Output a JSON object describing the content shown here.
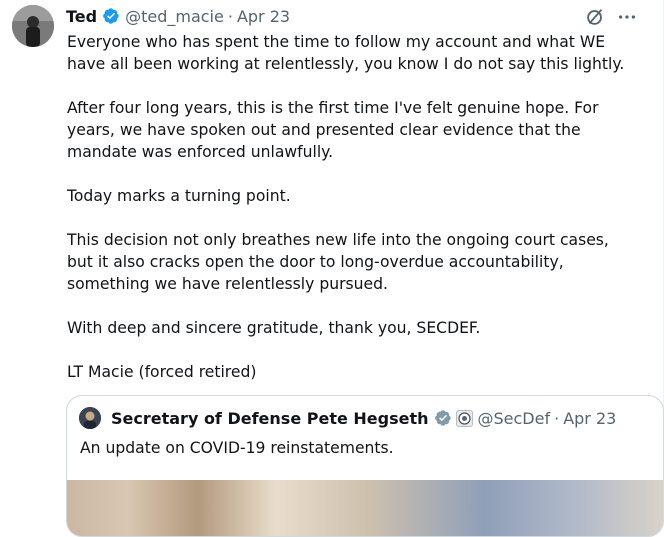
{
  "author": {
    "name": "Ted",
    "handle": "@ted_macie",
    "separator": "·",
    "date": "Apr 23"
  },
  "tweet": {
    "paragraphs": [
      "Everyone who has spent the time to follow my account and what WE have all been working at relentlessly, you know I do not say this lightly.",
      "After four long years, this is the first time I've felt genuine hope. For years, we have spoken out and presented clear evidence that the mandate was enforced unlawfully.",
      "Today marks a turning point.",
      "This decision not only breathes new life into the ongoing court cases, but it also cracks open the door to long-overdue accountability, something we have relentlessly pursued.",
      "With deep and sincere gratitude, thank you, SECDEF.",
      "LT Macie (forced retired)"
    ]
  },
  "quote": {
    "name": "Secretary of Defense Pete Hegseth",
    "handle": "@SecDef",
    "separator": "·",
    "date": "Apr 23",
    "text": "An update on COVID-19 reinstatements."
  },
  "icons": {
    "verified": "verified-badge-icon",
    "grok": "grok-icon",
    "more": "more-options-icon",
    "affiliation": "government-affiliation-icon"
  },
  "colors": {
    "verified": "#1d9bf0",
    "secondary_text": "#536471",
    "border": "#cfd9de"
  }
}
